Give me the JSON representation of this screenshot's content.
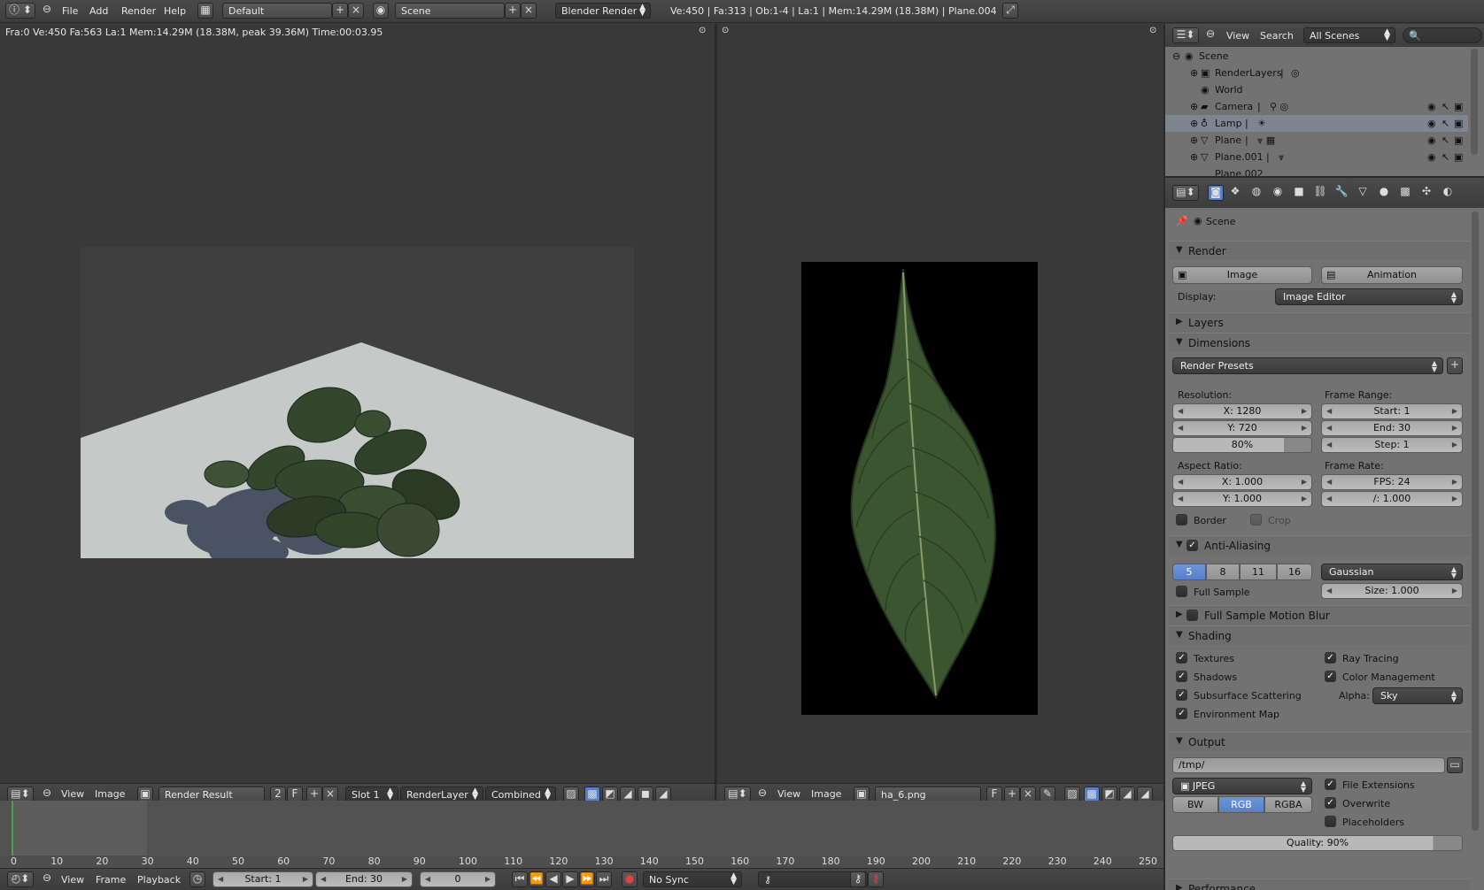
{
  "topbar": {
    "menus": [
      "File",
      "Add",
      "Render",
      "Help"
    ],
    "layout": "Default",
    "scene": "Scene",
    "engine": "Blender Render",
    "stats": "Ve:450 | Fa:313 | Ob:1-4 | La:1 | Mem:14.29M (18.38M) | Plane.004"
  },
  "left_viewer": {
    "stats": "Fra:0  Ve:450 Fa:563 La:1 Mem:14.29M (18.38M, peak 39.36M) Time:00:03.95",
    "header": {
      "view": "View",
      "image": "Image",
      "image_name": "Render Result",
      "users": "2",
      "fake": "F",
      "slot": "Slot 1",
      "layer": "RenderLayer",
      "pass": "Combined"
    }
  },
  "right_viewer": {
    "header": {
      "view": "View",
      "image": "Image",
      "image_name": "ha_6.png",
      "fake": "F"
    }
  },
  "outliner": {
    "menus": [
      "View",
      "Search"
    ],
    "filter": "All Scenes",
    "rows": [
      {
        "label": "Scene"
      },
      {
        "label": "RenderLayers"
      },
      {
        "label": "World"
      },
      {
        "label": "Camera"
      },
      {
        "label": "Lamp"
      },
      {
        "label": "Plane"
      },
      {
        "label": "Plane.001"
      },
      {
        "label": "Plane.002"
      }
    ]
  },
  "properties": {
    "context": "Scene",
    "render": {
      "title": "Render",
      "image_btn": "Image",
      "animation_btn": "Animation",
      "display_label": "Display:",
      "display_value": "Image Editor"
    },
    "layers_title": "Layers",
    "dimensions": {
      "title": "Dimensions",
      "presets": "Render Presets",
      "resolution_label": "Resolution:",
      "res_x": "X: 1280",
      "res_y": "Y: 720",
      "res_pct": "80%",
      "res_pct_value": 0.8,
      "frame_range_label": "Frame Range:",
      "start": "Start: 1",
      "end": "End: 30",
      "step": "Step: 1",
      "aspect_label": "Aspect Ratio:",
      "aspect_x": "X: 1.000",
      "aspect_y": "Y: 1.000",
      "frame_rate_label": "Frame Rate:",
      "fps": "FPS: 24",
      "fps_base": "/: 1.000",
      "border": "Border",
      "crop": "Crop"
    },
    "aa": {
      "title": "Anti-Aliasing",
      "samples": [
        "5",
        "8",
        "11",
        "16"
      ],
      "filter": "Gaussian",
      "full_sample": "Full Sample",
      "size": "Size: 1.000"
    },
    "motion_blur_title": "Full Sample Motion Blur",
    "shading": {
      "title": "Shading",
      "textures": "Textures",
      "shadows": "Shadows",
      "sss": "Subsurface Scattering",
      "env_map": "Environment Map",
      "ray_tracing": "Ray Tracing",
      "color_mgmt": "Color Management",
      "alpha_label": "Alpha:",
      "alpha_value": "Sky"
    },
    "output": {
      "title": "Output",
      "path": "/tmp/",
      "format": "JPEG",
      "bw": "BW",
      "rgb": "RGB",
      "rgba": "RGBA",
      "file_ext": "File Extensions",
      "overwrite": "Overwrite",
      "placeholders": "Placeholders",
      "quality": "Quality: 90%",
      "quality_value": 0.9
    },
    "performance_title": "Performance"
  },
  "timeline": {
    "ticks": [
      "0",
      "10",
      "20",
      "30",
      "40",
      "50",
      "60",
      "70",
      "80",
      "90",
      "100",
      "110",
      "120",
      "130",
      "140",
      "150",
      "160",
      "170",
      "180",
      "190",
      "200",
      "210",
      "220",
      "230",
      "240",
      "250"
    ],
    "menus": [
      "View",
      "Frame",
      "Playback"
    ],
    "start": "Start: 1",
    "end": "End: 30",
    "current": "0",
    "sync": "No Sync"
  }
}
